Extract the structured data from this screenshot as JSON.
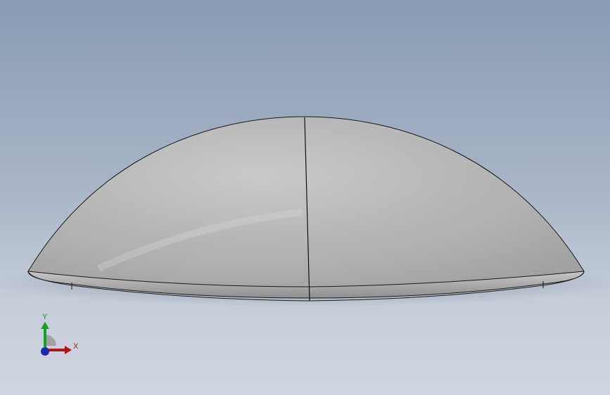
{
  "viewport": {
    "background_top": "#8a9bb2",
    "background_bottom": "#cfd5df"
  },
  "model": {
    "shape": "dome",
    "surface_color": "#b7b7b7",
    "edge_color": "#1a1a1a"
  },
  "triad": {
    "y_label": "Y",
    "x_label": "X",
    "y_color": "#1f9a2c",
    "x_color": "#b01818",
    "z_color": "#1f2aa8"
  }
}
